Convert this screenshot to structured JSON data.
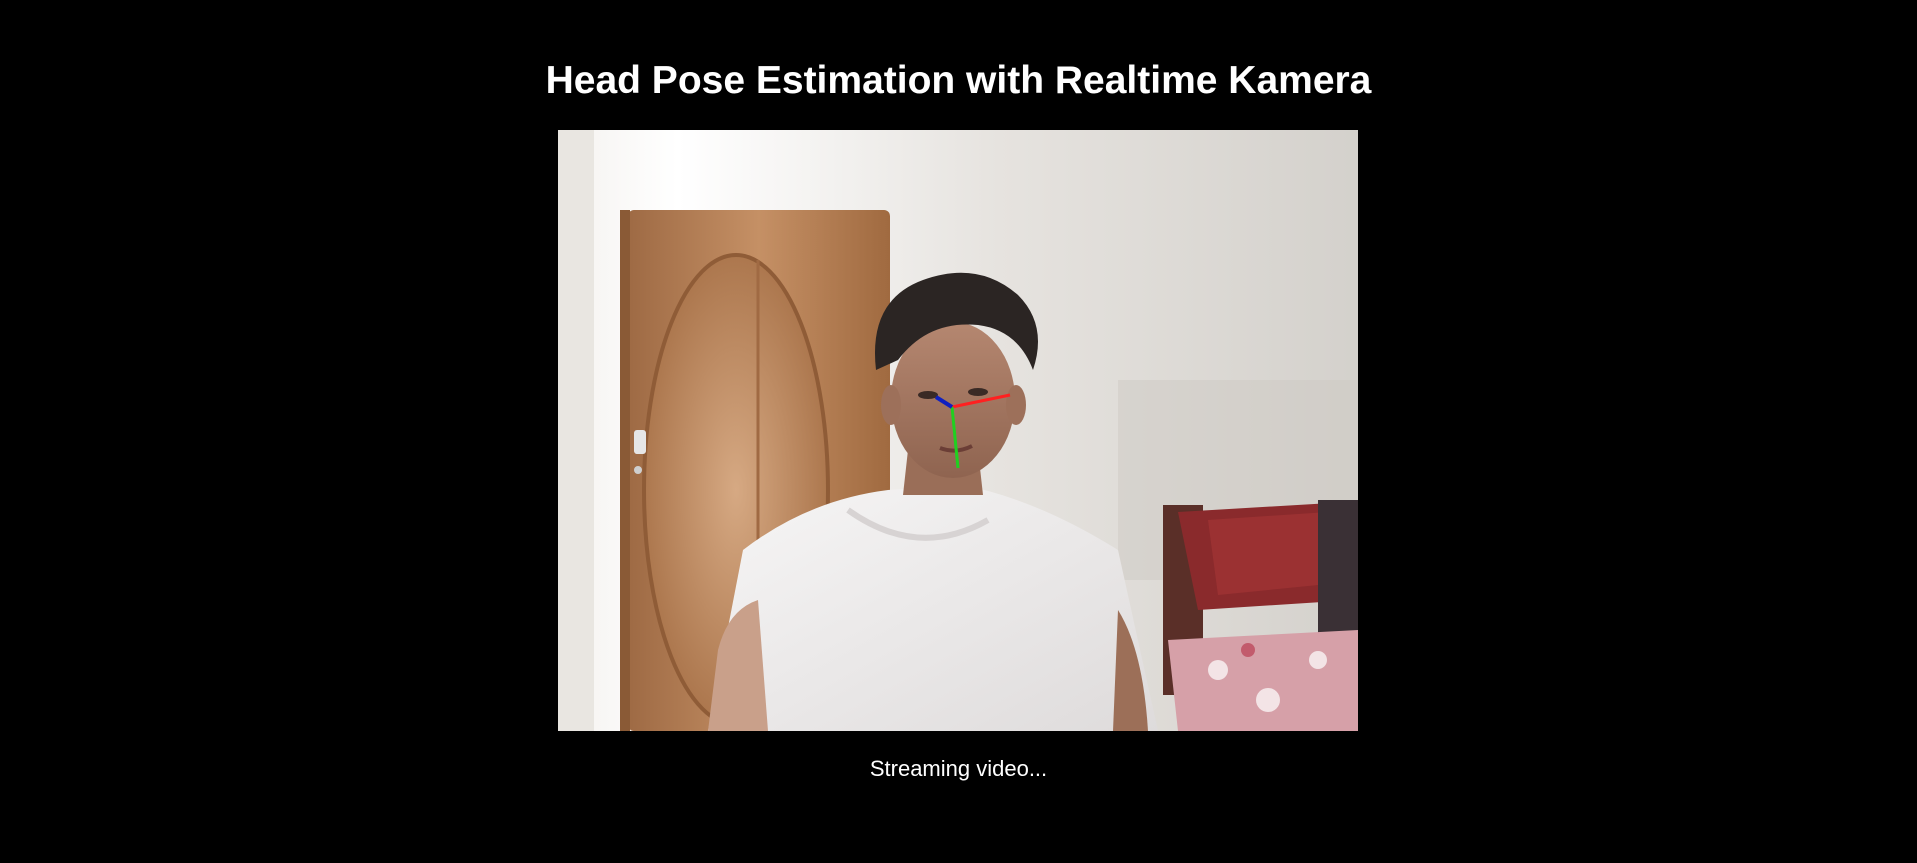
{
  "page": {
    "title": "Head Pose Estimation with Realtime Kamera",
    "status_text": "Streaming video..."
  },
  "colors": {
    "background": "#000000",
    "text": "#ffffff",
    "pose_axis_x": "#ff2020",
    "pose_axis_y": "#20d020",
    "pose_axis_z": "#1020c0"
  },
  "video": {
    "content": "webcam-frame",
    "overlay": "head-pose-axes"
  }
}
